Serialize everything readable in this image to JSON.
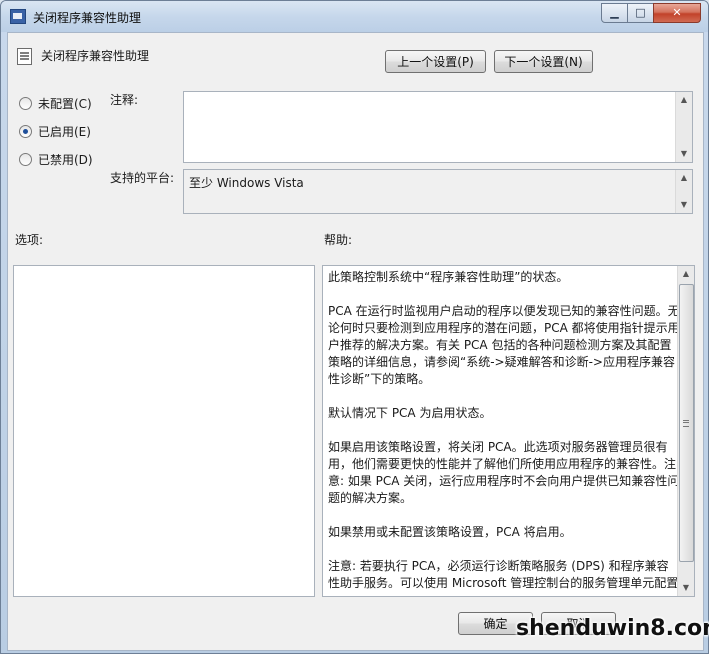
{
  "window": {
    "title": "关闭程序兼容性助理",
    "min_glyph": "▁",
    "max_glyph": "□",
    "close_glyph": "✕"
  },
  "policy": {
    "name": "关闭程序兼容性助理",
    "prev_button": "上一个设置(P)",
    "next_button": "下一个设置(N)"
  },
  "state": {
    "options": [
      {
        "label": "未配置(C)",
        "selected": false
      },
      {
        "label": "已启用(E)",
        "selected": true
      },
      {
        "label": "已禁用(D)",
        "selected": false
      }
    ]
  },
  "comment": {
    "label": "注释:",
    "value": ""
  },
  "platform": {
    "label": "支持的平台:",
    "value": "至少 Windows Vista"
  },
  "options_pane": {
    "label": "选项:"
  },
  "help_pane": {
    "label": "帮助:",
    "paragraphs": [
      "此策略控制系统中“程序兼容性助理”的状态。",
      "PCA 在运行时监视用户启动的程序以便发现已知的兼容性问题。无论何时只要检测到应用程序的潜在问题，PCA 都将使用指针提示用户推荐的解决方案。有关 PCA 包括的各种问题检测方案及其配置策略的详细信息，请参阅“系统->疑难解答和诊断->应用程序兼容性诊断”下的策略。",
      "默认情况下 PCA 为启用状态。",
      "如果启用该策略设置，将关闭 PCA。此选项对服务器管理员很有用，他们需要更快的性能并了解他们所使用应用程序的兼容性。注意: 如果 PCA 关闭，运行应用程序时不会向用户提供已知兼容性问题的解决方案。",
      "如果禁用或未配置该策略设置，PCA 将启用。",
      "注意: 若要执行 PCA，必须运行诊断策略服务 (DPS) 和程序兼容性助手服务。可以使用 Microsoft 管理控制台的服务管理单元配置"
    ]
  },
  "footer": {
    "ok_button": "确定",
    "cancel_button": "取消"
  },
  "watermark": {
    "text": "shenduwin8.com"
  }
}
